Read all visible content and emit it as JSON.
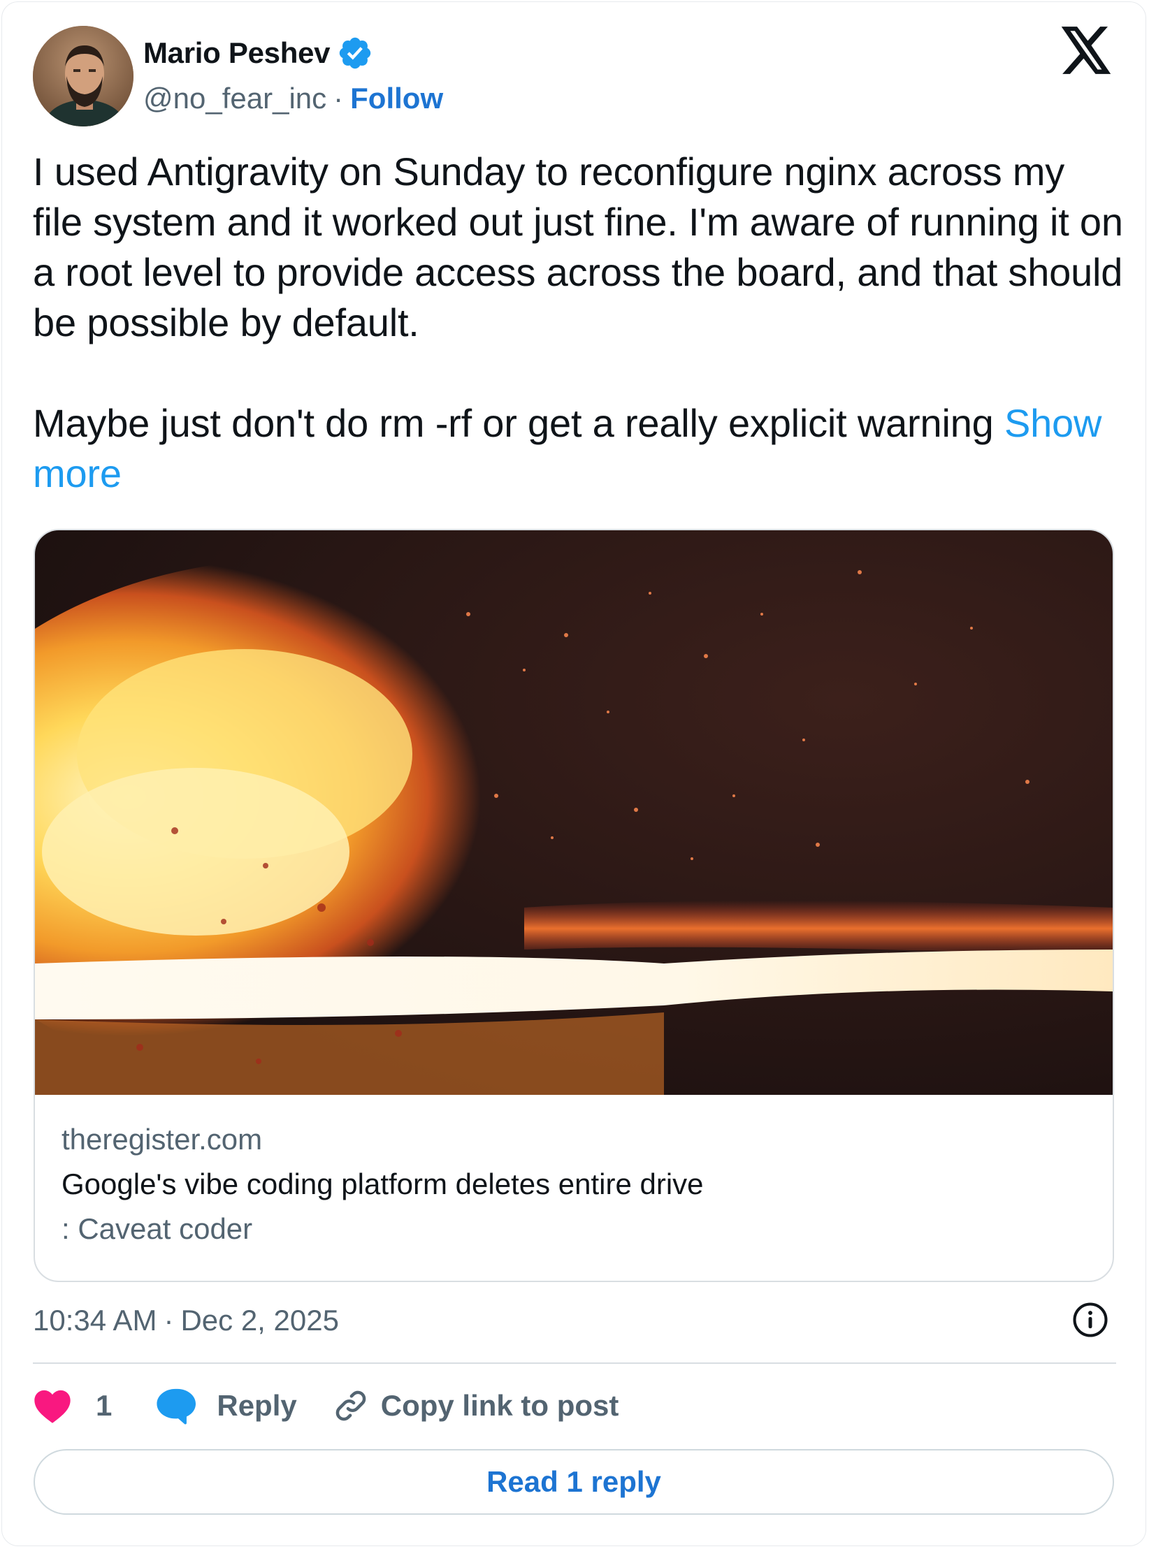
{
  "author": {
    "name": "Mario Peshev",
    "handle": "@no_fear_inc",
    "separator": "·",
    "follow_label": "Follow",
    "verified_color": "#1d9bf0"
  },
  "post": {
    "text": "I used Antigravity on Sunday to reconfigure nginx across my file system and it worked out just fine. I'm aware of running it on a root level to provide access across the board, and that should be possible by default.\n\nMaybe just don't do rm -rf or get a really explicit warning ",
    "show_more": "Show more"
  },
  "link_card": {
    "domain": "theregister.com",
    "title": "Google's vibe coding platform deletes entire drive",
    "description": ": Caveat coder",
    "image_icon": "explosion-image"
  },
  "meta": {
    "time": "10:34 AM",
    "separator": "·",
    "date": "Dec 2, 2025"
  },
  "actions": {
    "like_count": "1",
    "reply_label": "Reply",
    "copy_link_label": "Copy link to post"
  },
  "read_replies_label": "Read 1 reply",
  "colors": {
    "accent": "#1d74d2",
    "link": "#1d9bf0",
    "like": "#f91880",
    "muted": "#536471"
  }
}
